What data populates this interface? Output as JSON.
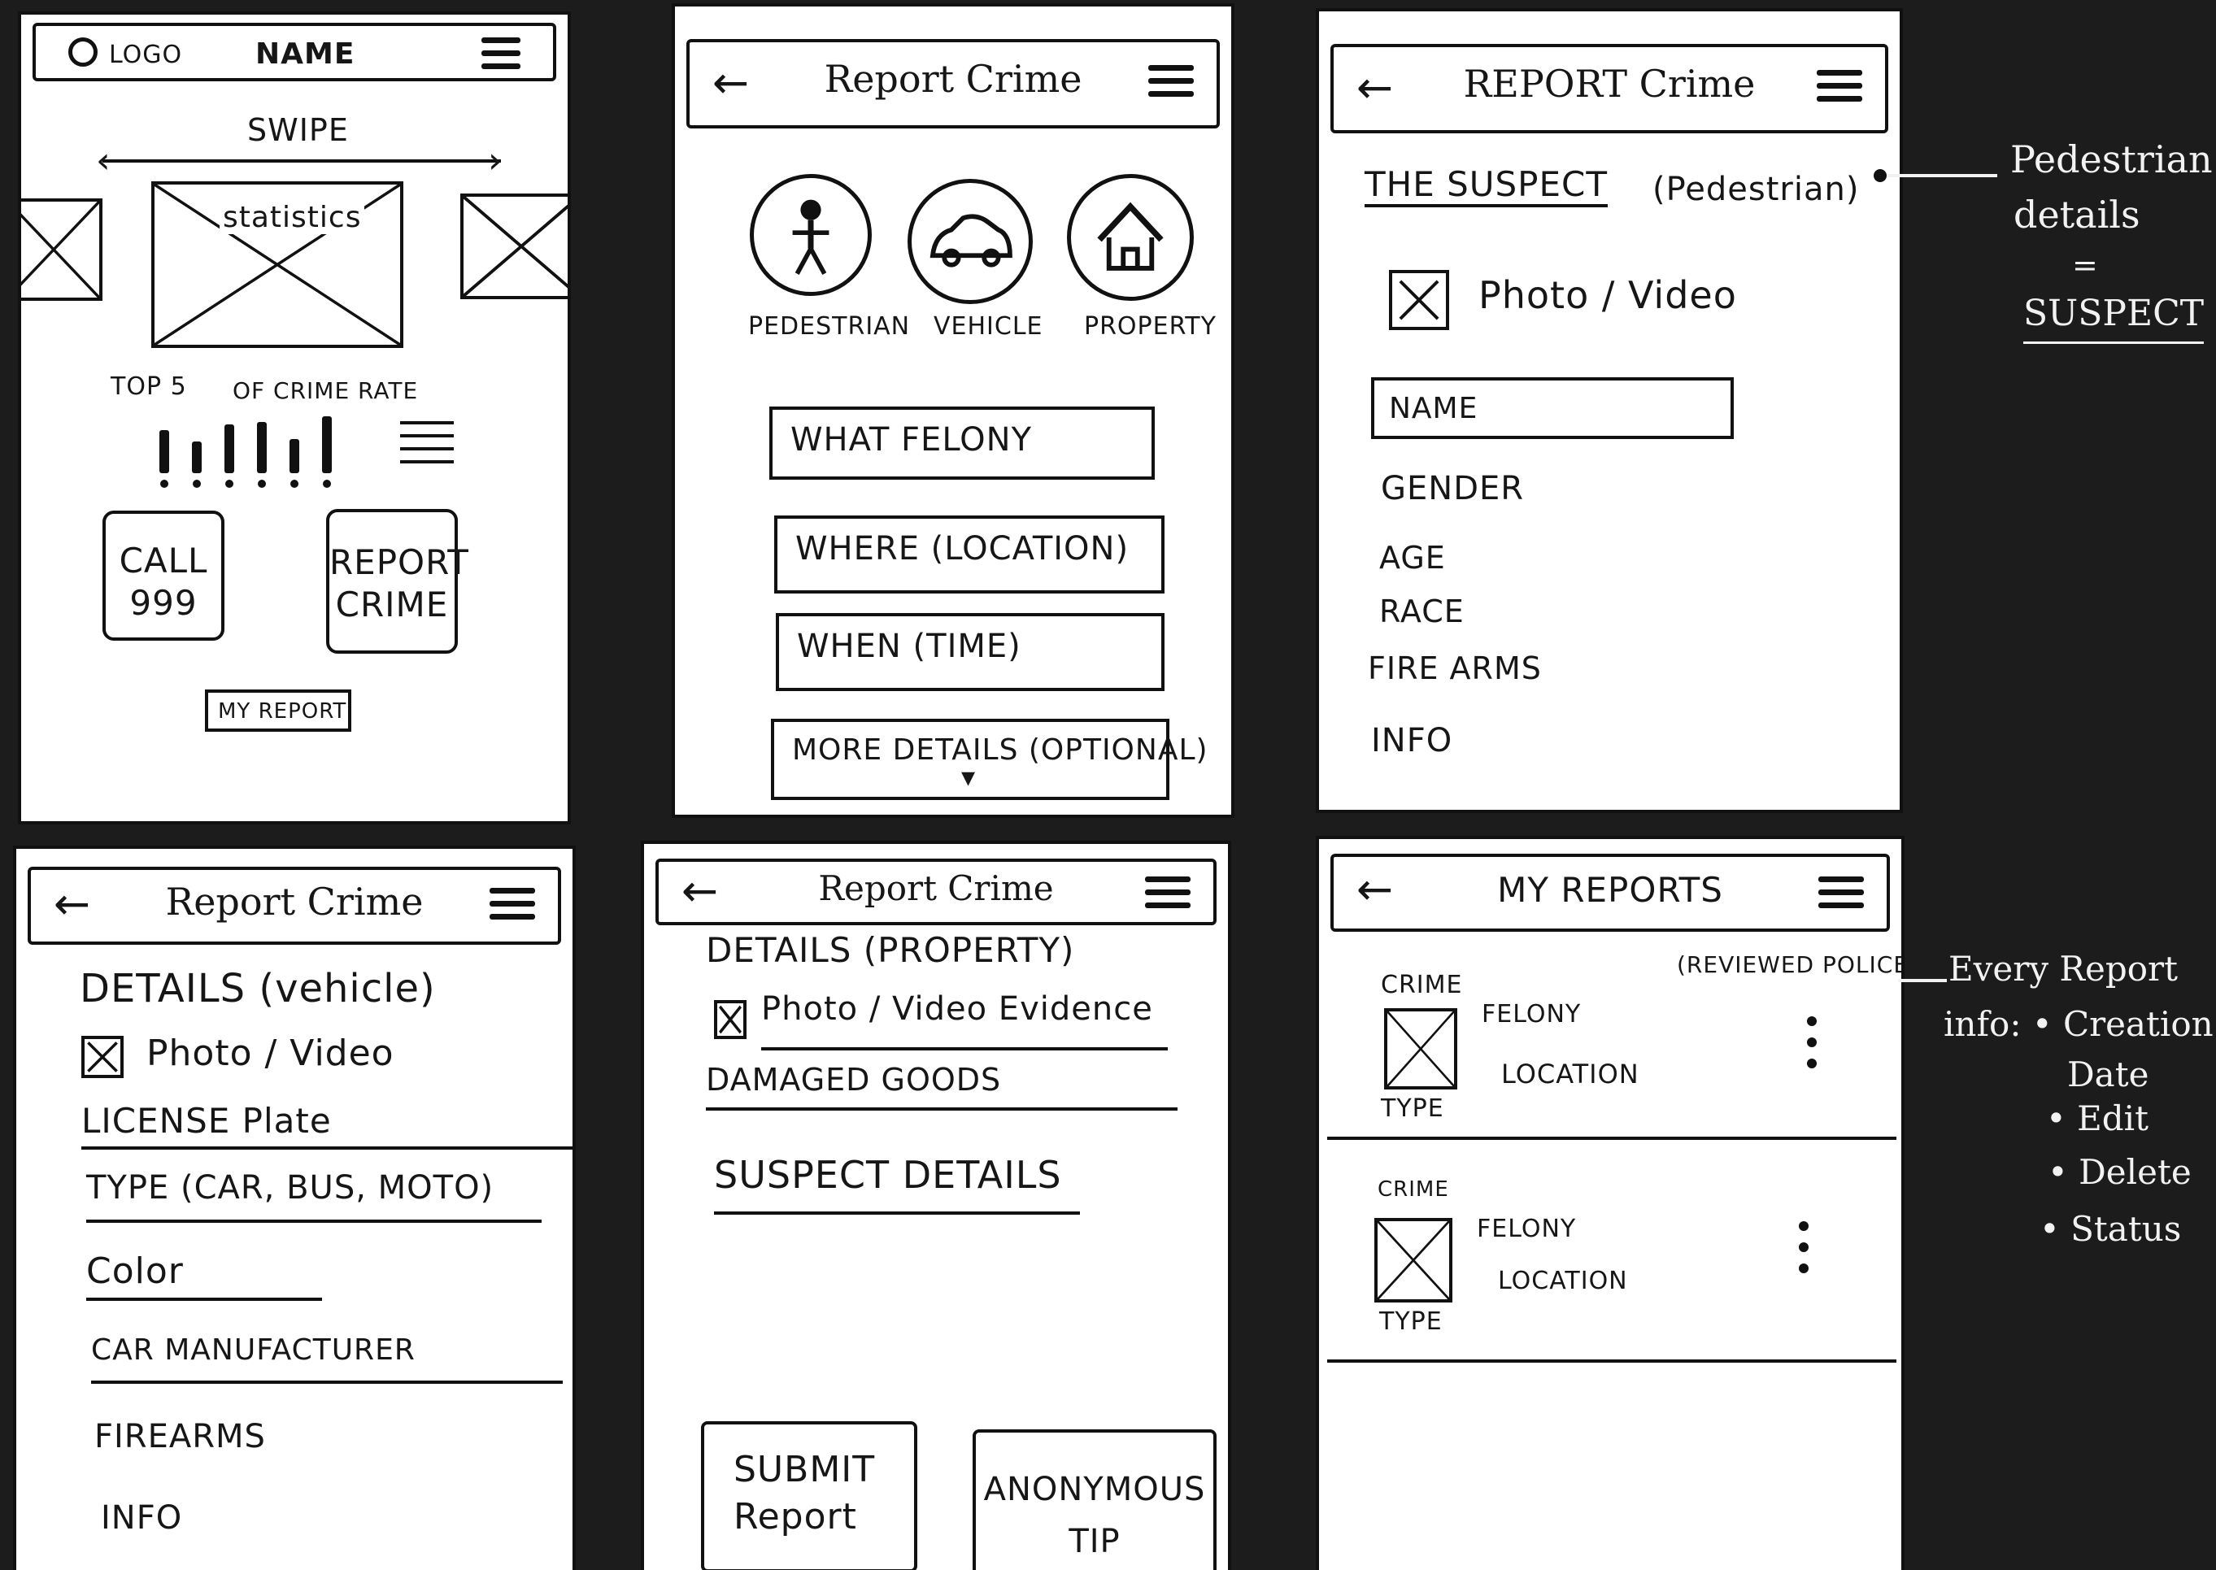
{
  "screen_home": {
    "logo": "LOGO",
    "name": "NAME",
    "swipe": "SWIPE",
    "carousel_label": "statistics",
    "top5_label": "TOP 5",
    "crime_rate_label": "OF CRIME RATE",
    "call_label_1": "CALL",
    "call_label_2": "999",
    "report_label_1": "REPORT",
    "report_label_2": "CRIME",
    "my_report": "MY REPORT",
    "bar_levels": [
      0.75,
      0.55,
      0.85,
      0.9,
      0.6,
      1.0
    ]
  },
  "screen_report": {
    "title": "Report Crime",
    "categories": [
      "PEDESTRIAN",
      "VEHICLE",
      "PROPERTY"
    ],
    "fields": [
      "WHAT FELONY",
      "WHERE (LOCATION)",
      "WHEN (TIME)",
      "MORE DETAILS (OPTIONAL)"
    ]
  },
  "screen_suspect": {
    "title": "REPORT Crime",
    "section": "THE SUSPECT",
    "section_qualifier": "(Pedestrian)",
    "photo": "Photo / Video",
    "name_field": "NAME",
    "labels": [
      "GENDER",
      "AGE",
      "RACE",
      "FIRE ARMS",
      "INFO"
    ]
  },
  "screen_vehicle": {
    "title": "Report Crime",
    "section": "DETAILS (vehicle)",
    "photo": "Photo / Video",
    "fields": [
      "LICENSE Plate",
      "TYPE (CAR, BUS, MOTO)",
      "Color",
      "CAR MANUFACTURER"
    ],
    "labels": [
      "FIREARMS",
      "INFO"
    ]
  },
  "screen_property": {
    "title": "Report Crime",
    "section": "DETAILS (PROPERTY)",
    "photo": "Photo / Video Evidence",
    "fields": [
      "DAMAGED GOODS",
      "SUSPECT DETAILS"
    ],
    "submit_1": "SUBMIT",
    "submit_2": "Report",
    "anon_1": "ANONYMOUS",
    "anon_2": "TIP"
  },
  "screen_myreports": {
    "title": "MY REPORTS",
    "reviewed": "(REVIEWED POLICE)",
    "item_crime": "CRIME",
    "item_type": "TYPE",
    "item_felony": "FELONY",
    "item_location": "LOCATION"
  },
  "annotations": {
    "suspect_note": [
      "Pedestrian",
      "details",
      "=",
      "SUSPECT"
    ],
    "reports_note": [
      "Every Report",
      "info: • Creation",
      "Date",
      "• Edit",
      "• Delete",
      "• Status"
    ]
  }
}
